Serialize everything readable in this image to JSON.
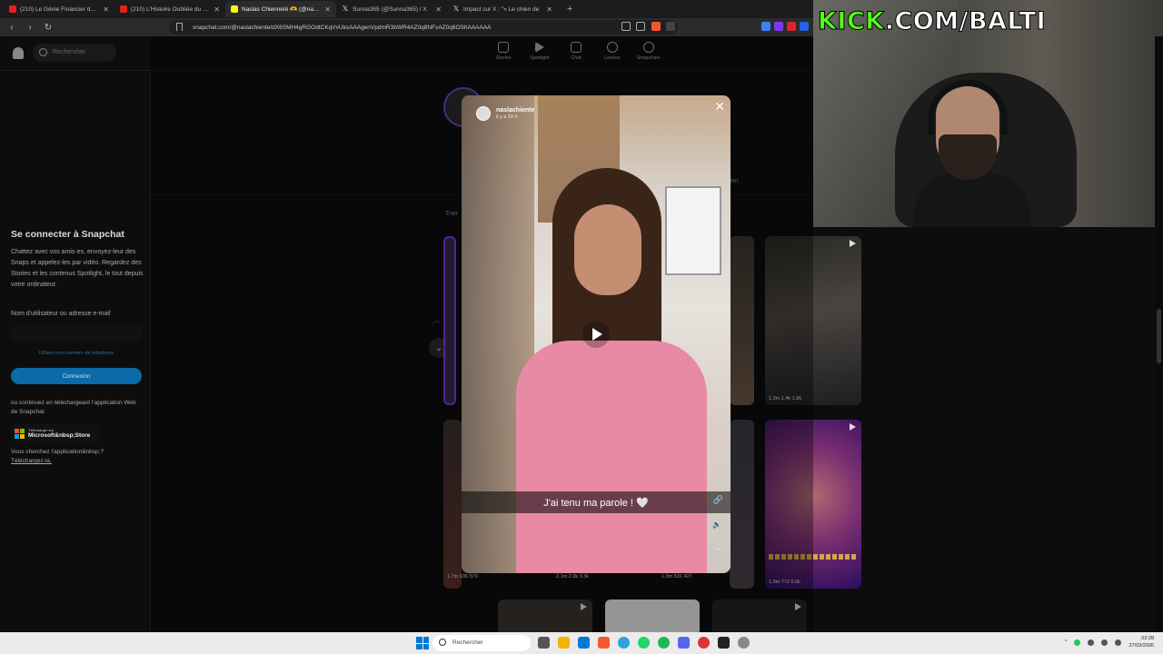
{
  "browser": {
    "tabs": [
      {
        "label": "(210) Le Génie Financier des Omeyya",
        "favicon": "youtube-icon",
        "active": false
      },
      {
        "label": "(210) L'Histoire Oubliée du Président",
        "favicon": "youtube-icon",
        "active": false
      },
      {
        "label": "Naslas Chienneté 🫶 (@naslachiente)",
        "favicon": "snapchat-icon",
        "active": true
      },
      {
        "label": "Sunna365 (@Sunna365) / X",
        "favicon": "x-icon",
        "active": false
      },
      {
        "label": "Impact sur X : \"« Le chien de",
        "favicon": "x-icon",
        "active": false
      }
    ],
    "url": "snapchat.com/@naslachiente/dX6SMH4gRGOdtCKqVvUksAAAgenVpdmR3bWR4AZ0q8NFsAZ0q6OShAAAAAA"
  },
  "snapchat": {
    "search_placeholder": "Rechercher",
    "nav": [
      {
        "label": "Stories",
        "icon": "stories-icon"
      },
      {
        "label": "Spotlight",
        "icon": "spotlight-icon"
      },
      {
        "label": "Chat",
        "icon": "chat-icon"
      },
      {
        "label": "Lenses",
        "icon": "lenses-icon"
      },
      {
        "label": "Snapchat+",
        "icon": "snapchat-plus-icon"
      }
    ],
    "sidebar": {
      "title": "Se connecter à Snapchat",
      "description": "Chattez avec vos amis·es, envoyez-leur des Snaps et appelez-les par vidéo. Regardez des Stories et les contenus Spotlight, le tout depuis votre ordinateur.",
      "field_label": "Nom d'utilisateur ou adresse e-mail",
      "phone_link": "Utiliser mon numéro de téléphone",
      "connect_button": "Connexion",
      "or_text": "ou continuez en téléchargeant l'application Web de Snapchat",
      "store_small": "Télécharger sur",
      "store_big": "Microsoft&nbsp;Store",
      "app_question": "Vous cherchez l'application&nbsp;?",
      "app_download": "Téléchargez-la."
    },
    "sort_label": "Trier",
    "tab_partial": "lien",
    "tiles": [
      {
        "stats": "1.3m  1.4k  1.8k"
      },
      {
        "stats": "1.9m  772  6.0k"
      }
    ],
    "bottom_stats": [
      "1.7m  636  570",
      "2.1m  2.0k  3.3k",
      "1.0m  531  427"
    ]
  },
  "story": {
    "username": "naslachiente",
    "time": "il y a 10 h",
    "caption": "J'ai tenu ma parole ! 🤍"
  },
  "stream": {
    "overlay_prefix": "KICK",
    "overlay_suffix": ".COM/BALTI"
  },
  "taskbar": {
    "search_placeholder": "Rechercher",
    "time": "03:28",
    "date": "27/03/2026"
  }
}
